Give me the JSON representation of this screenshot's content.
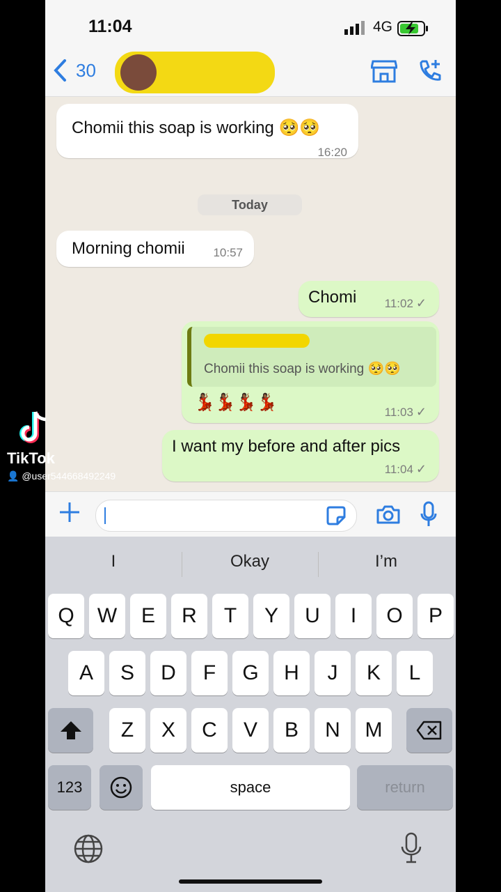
{
  "status": {
    "time": "11:04",
    "network": "4G"
  },
  "header": {
    "back_count": "30"
  },
  "messages": [
    {
      "text": "Chomii this soap is working 🥺🥺",
      "time": "16:20"
    },
    {
      "date": "Today"
    },
    {
      "text": "Morning chomii",
      "time": "10:57"
    },
    {
      "text": "Chomi",
      "time": "11:02",
      "tick": "✓"
    },
    {
      "quote": "Chomii this soap is working 🥺🥺",
      "text": "💃🏾💃🏾💃🏾💃🏾",
      "time": "11:03",
      "tick": "✓"
    },
    {
      "text": "I want my before and after pics",
      "time": "11:04",
      "tick": "✓"
    }
  ],
  "keyboard": {
    "suggestions": [
      "I",
      "Okay",
      "I’m"
    ],
    "row1": [
      "Q",
      "W",
      "E",
      "R",
      "T",
      "Y",
      "U",
      "I",
      "O",
      "P"
    ],
    "row2": [
      "A",
      "S",
      "D",
      "F",
      "G",
      "H",
      "J",
      "K",
      "L"
    ],
    "row3": [
      "Z",
      "X",
      "C",
      "V",
      "B",
      "N",
      "M"
    ],
    "numbers": "123",
    "space": "space",
    "return": "return"
  },
  "overlay": {
    "brand": "TikTok",
    "user": "@user544668492249"
  },
  "colors": {
    "accent": "#2e7de0",
    "outgoing": "#dcf8c6",
    "redaction": "#f2d600"
  }
}
